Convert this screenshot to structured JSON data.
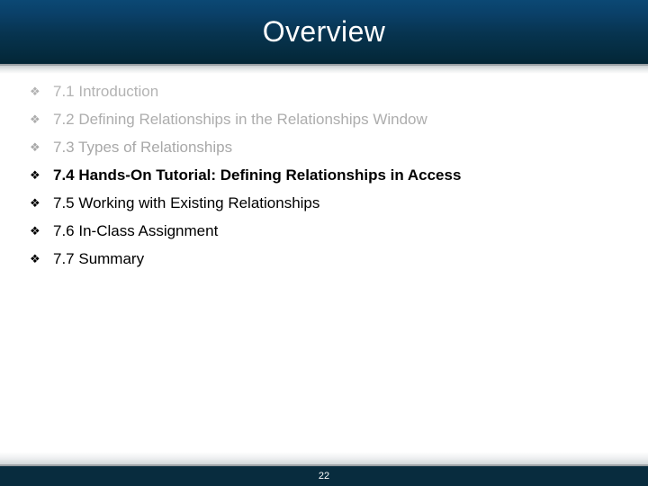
{
  "slide": {
    "title": "Overview",
    "page_number": "22",
    "bullet_glyph": "❖",
    "colors": {
      "banner_top": "#0b4874",
      "banner_bottom": "#032636",
      "footer_band": "#082c3e",
      "title_text": "#ffffff",
      "dimmed_text": "#b3b3b3",
      "active_text": "#000000",
      "rule": "#9aa0a4"
    },
    "items": [
      {
        "label": "7.1 Introduction",
        "tone": "gray",
        "emphasis": "normal"
      },
      {
        "label": "7.2 Defining Relationships in the Relationships Window",
        "tone": "gray",
        "emphasis": "normal"
      },
      {
        "label": "7.3 Types of Relationships",
        "tone": "gray",
        "emphasis": "normal"
      },
      {
        "label": "7.4 Hands-On Tutorial: Defining Relationships in Access",
        "tone": "dark",
        "emphasis": "bold"
      },
      {
        "label": "7.5 Working with Existing Relationships",
        "tone": "dark",
        "emphasis": "normal"
      },
      {
        "label": "7.6 In-Class Assignment",
        "tone": "dark",
        "emphasis": "normal"
      },
      {
        "label": "7.7 Summary",
        "tone": "dark",
        "emphasis": "normal"
      }
    ]
  }
}
